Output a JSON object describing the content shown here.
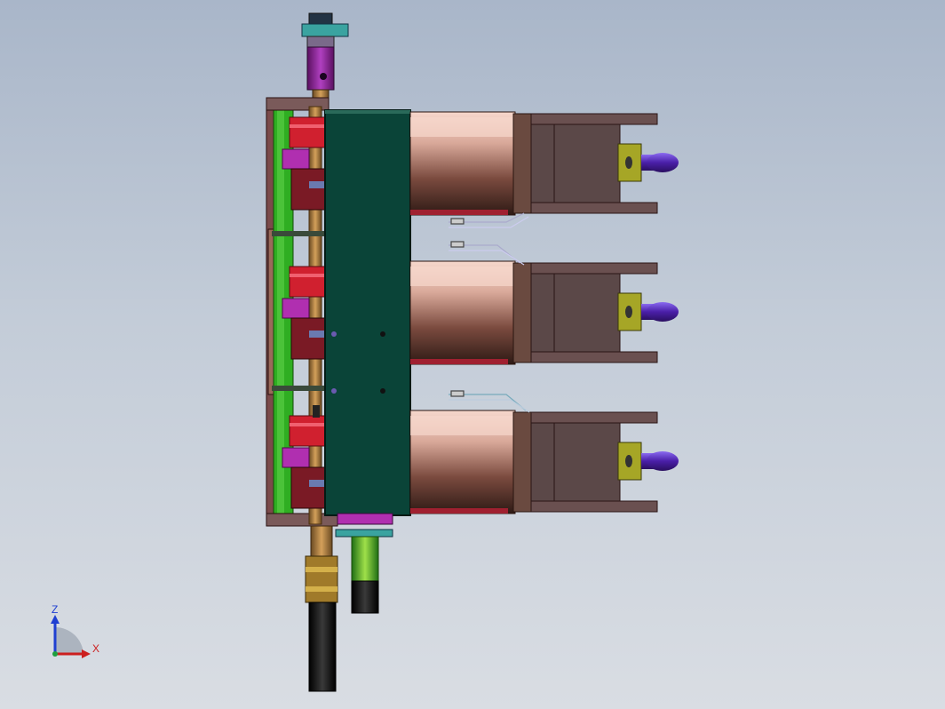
{
  "viewport": {
    "background_top": "#a9b6c9",
    "background_bottom": "#d9dde3"
  },
  "triad": {
    "z_label": "Z",
    "x_label": "X",
    "z_color": "#1f3fd1",
    "x_color": "#cc1f1f",
    "y_color": "#1f9f3f"
  },
  "model": {
    "description_icon": "cad-assembly-view",
    "colors": {
      "main_block": "#0a4438",
      "green_plate": "#2fae22",
      "cylinder_light": "#f1cfc3",
      "cylinder_dark": "#3a1f18",
      "bracket": "#5b4848",
      "knob": "#5b2db5",
      "magenta": "#b02fb0",
      "red": "#d0202f",
      "olive": "#a6a626",
      "shaft_copper": "#b07a3a",
      "teal": "#3aa3a0"
    }
  }
}
